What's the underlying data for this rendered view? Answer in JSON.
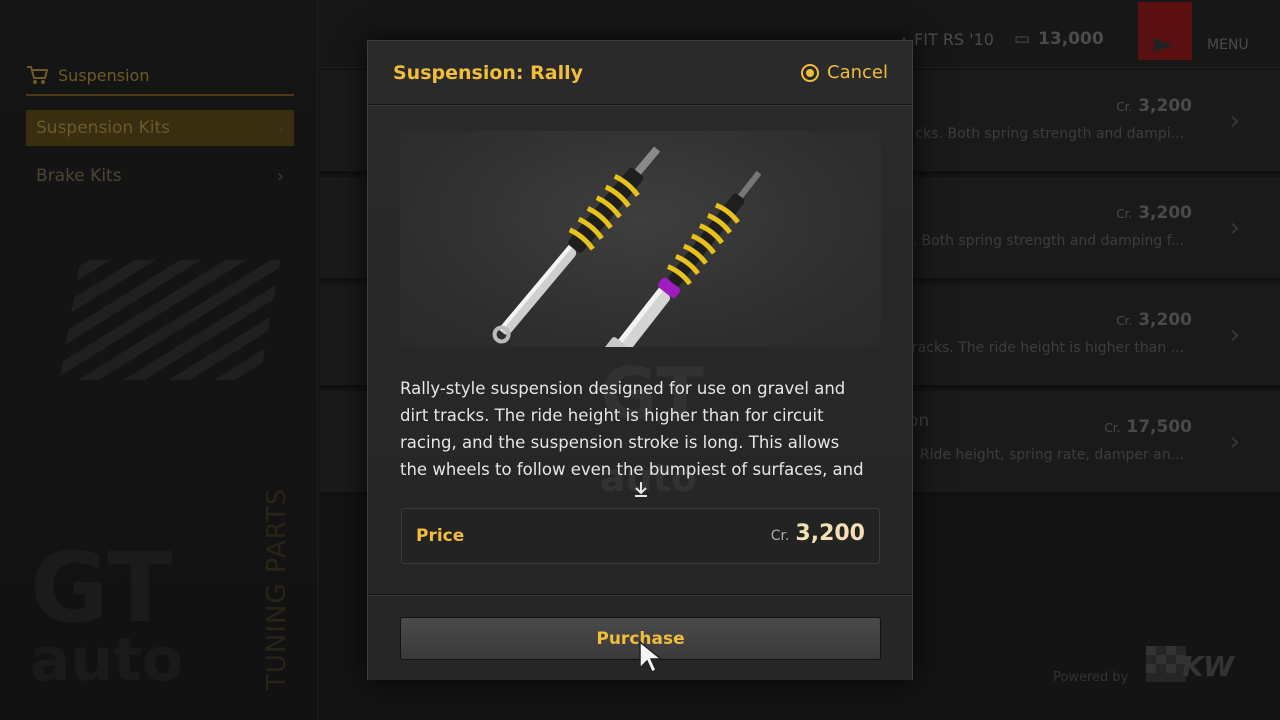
{
  "sidebar": {
    "category_title": "Suspension",
    "items": [
      {
        "label": "Suspension Kits",
        "active": true
      },
      {
        "label": "Brake Kits",
        "active": false
      }
    ],
    "section_label": "TUNING PARTS",
    "watermark_top": "GT",
    "watermark_bottom": "auto"
  },
  "header": {
    "car": "FIT RS '10",
    "credits": "13,000",
    "menu_label": "MENU"
  },
  "list": {
    "rows": [
      {
        "name": "",
        "currency": "Cr.",
        "price": "3,200",
        "desc": "cks. Both spring strength and dampi..."
      },
      {
        "name": "",
        "currency": "Cr.",
        "price": "3,200",
        "desc": ". Both spring strength and damping f..."
      },
      {
        "name": "",
        "currency": "Cr.",
        "price": "3,200",
        "desc": "racks. The ride height is higher than ..."
      },
      {
        "name": "on",
        "currency": "Cr.",
        "price": "17,500",
        "desc": "Ride height, spring rate, damper an..."
      }
    ]
  },
  "footer": {
    "powered_by": "Powered by"
  },
  "dialog": {
    "title": "Suspension: Rally",
    "cancel_label": "Cancel",
    "description": "Rally-style suspension designed for use on gravel and dirt tracks. The ride height is higher than for circuit racing, and the suspension stroke is long. This allows the wheels to follow even the bumpiest of surfaces, and as much",
    "price_label": "Price",
    "price_currency": "Cr.",
    "price_value": "3,200",
    "purchase_label": "Purchase"
  },
  "colors": {
    "accent": "#f0bd3c",
    "spring": "#e8c21a",
    "purple_ring": "#a01cc0"
  },
  "icons": [
    "cart-icon",
    "car-icon",
    "credits-icon",
    "cancel-circle-icon",
    "scroll-down-icon",
    "chevron-right-icon",
    "pointer-cursor-icon"
  ]
}
